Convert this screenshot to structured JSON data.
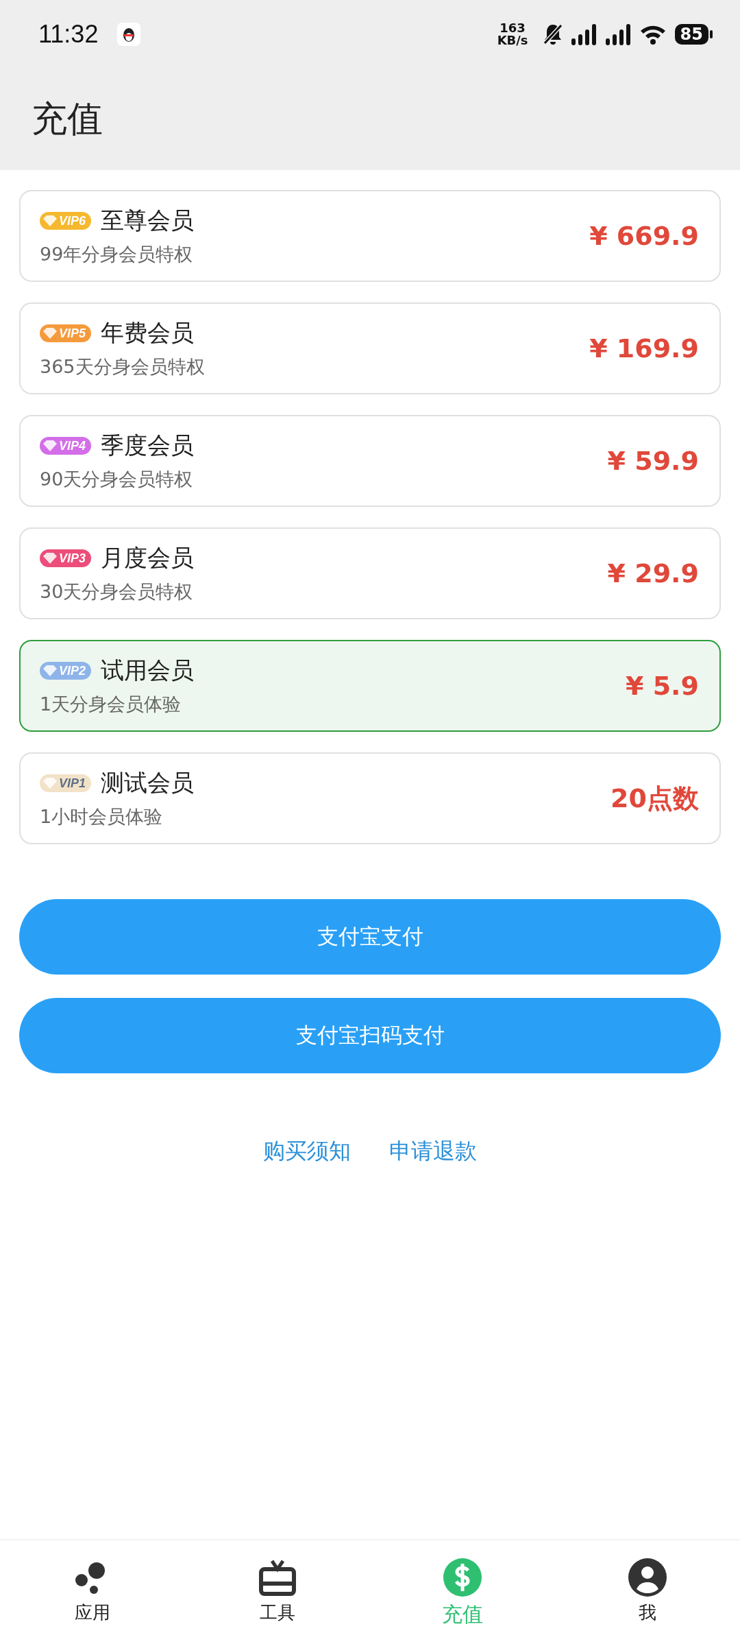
{
  "status_bar": {
    "time": "11:32",
    "net_speed": "163",
    "net_unit": "KB/s",
    "battery": "85"
  },
  "header": {
    "title": "充值"
  },
  "plans": [
    {
      "badge": "VIP6",
      "color": "#f5b82e",
      "name": "至尊会员",
      "desc": "99年分身会员特权",
      "price": "¥ 669.9",
      "selected": false
    },
    {
      "badge": "VIP5",
      "color": "#f59a3c",
      "name": "年费会员",
      "desc": "365天分身会员特权",
      "price": "¥ 169.9",
      "selected": false
    },
    {
      "badge": "VIP4",
      "color": "#d46ee8",
      "name": "季度会员",
      "desc": "90天分身会员特权",
      "price": "¥ 59.9",
      "selected": false
    },
    {
      "badge": "VIP3",
      "color": "#ec4d7a",
      "name": "月度会员",
      "desc": "30天分身会员特权",
      "price": "¥ 29.9",
      "selected": false
    },
    {
      "badge": "VIP2",
      "color": "#8fb4ea",
      "name": "试用会员",
      "desc": "1天分身会员体验",
      "price": "¥ 5.9",
      "selected": true
    },
    {
      "badge": "VIP1",
      "color": "#f2e2c8",
      "name": "测试会员",
      "desc": "1小时会员体验",
      "price": "20点数",
      "selected": false
    }
  ],
  "buttons": [
    "支付宝支付",
    "支付宝扫码支付"
  ],
  "links": [
    "购买须知",
    "申请退款"
  ],
  "nav": [
    {
      "label": "应用",
      "kind": "apps",
      "selected": false
    },
    {
      "label": "工具",
      "kind": "tools",
      "selected": false
    },
    {
      "label": "充值",
      "kind": "recharge",
      "selected": true
    },
    {
      "label": "我",
      "kind": "me",
      "selected": false
    }
  ]
}
